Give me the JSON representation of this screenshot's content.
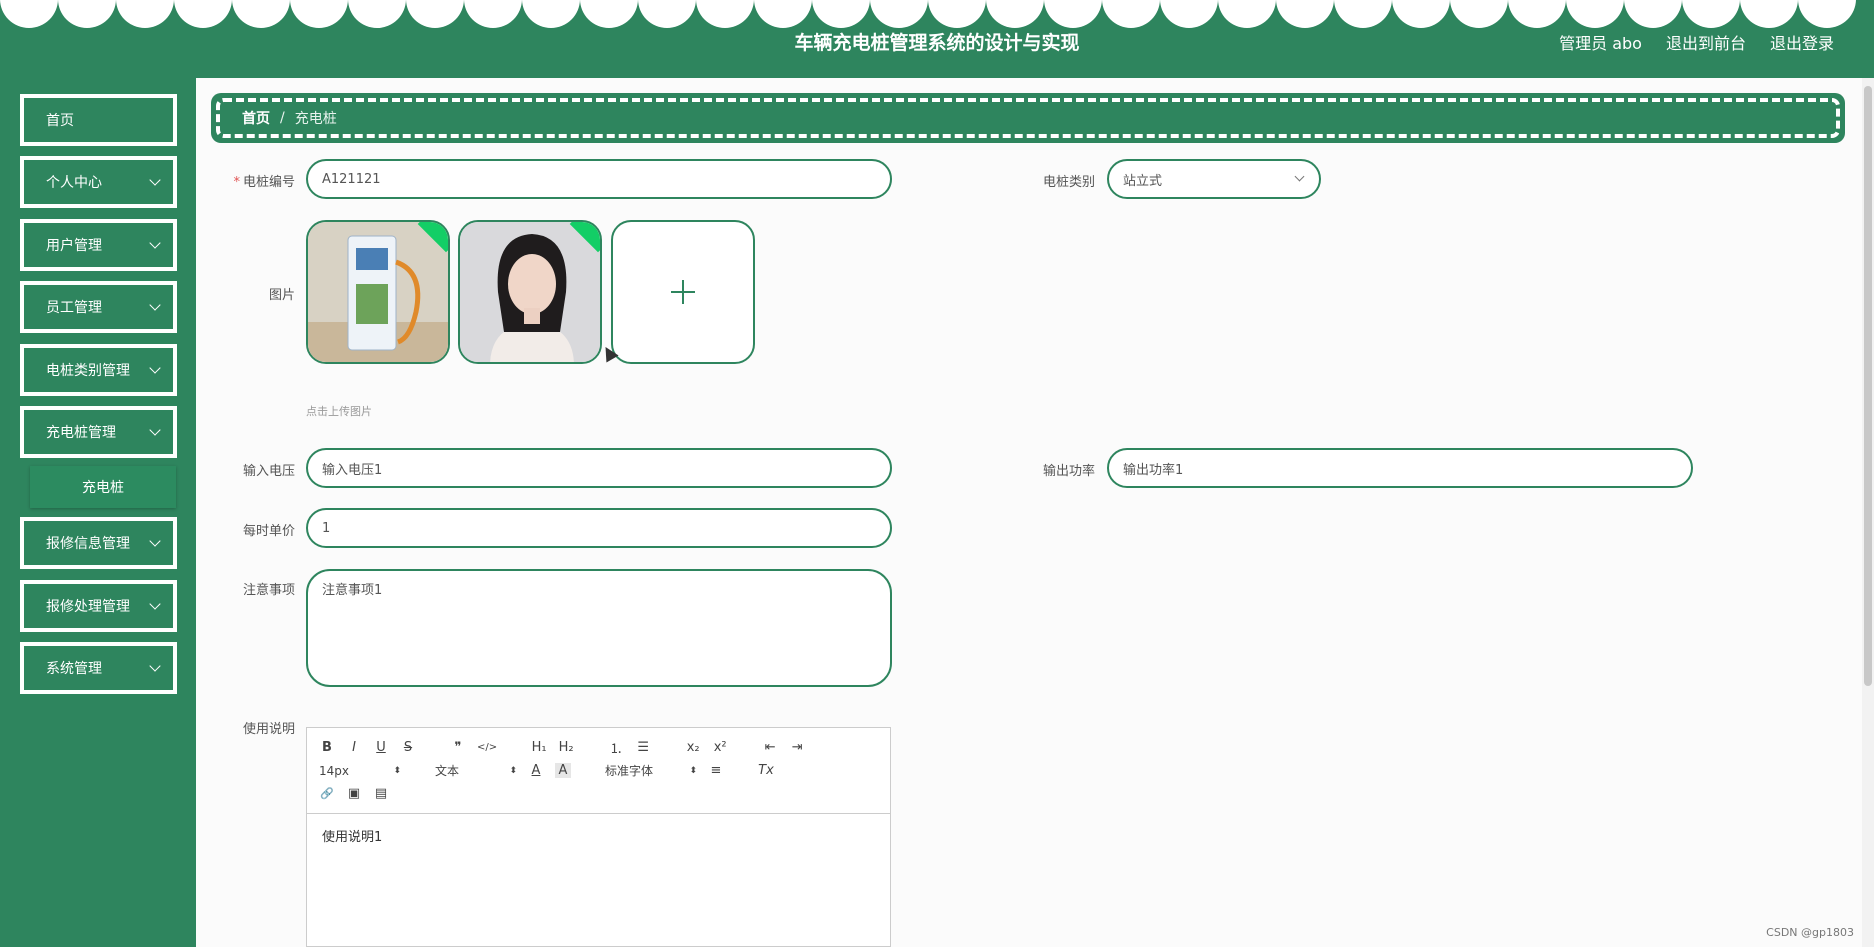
{
  "header": {
    "title": "车辆充电桩管理系统的设计与实现",
    "user": "管理员 abo",
    "front_link": "退出到前台",
    "logout_link": "退出登录"
  },
  "sidebar": {
    "items": [
      {
        "label": "首页"
      },
      {
        "label": "个人中心"
      },
      {
        "label": "用户管理"
      },
      {
        "label": "员工管理"
      },
      {
        "label": "电桩类别管理"
      },
      {
        "label": "充电桩管理"
      },
      {
        "label": "报修信息管理"
      },
      {
        "label": "报修处理管理"
      },
      {
        "label": "系统管理"
      }
    ],
    "sub_item": "充电桩"
  },
  "breadcrumb": {
    "home": "首页",
    "separator": "/",
    "current": "充电桩"
  },
  "form": {
    "pile_no": {
      "label": "电桩编号",
      "value": "A121121"
    },
    "pile_type": {
      "label": "电桩类别",
      "value": "站立式"
    },
    "image": {
      "label": "图片",
      "hint": "点击上传图片"
    },
    "input_voltage": {
      "label": "输入电压",
      "value": "输入电压1"
    },
    "output_power": {
      "label": "输出功率",
      "value": "输出功率1"
    },
    "unit_price": {
      "label": "每时单价",
      "value": "1"
    },
    "notes": {
      "label": "注意事项",
      "value": "注意事项1"
    },
    "instructions": {
      "label": "使用说明",
      "value": "使用说明1"
    }
  },
  "editor": {
    "font_size": "14px",
    "format": "文本",
    "font_family": "标准字体",
    "buttons": {
      "bold": "B",
      "italic": "I",
      "underline": "U",
      "strike": "S",
      "quote": "❞",
      "code": "</>",
      "h1": "H₁",
      "h2": "H₂",
      "ol": "⒈",
      "ul": "☰",
      "sub": "x₂",
      "sup": "x²",
      "outdent": "⇤",
      "indent": "⇥",
      "color": "A",
      "background": "A",
      "align": "≡",
      "clean": "Tx",
      "link": "🔗",
      "image": "▣",
      "video": "▤"
    }
  },
  "watermark": "CSDN @gp1803",
  "colors": {
    "primary": "#2e855e",
    "check": "#13ce66"
  }
}
